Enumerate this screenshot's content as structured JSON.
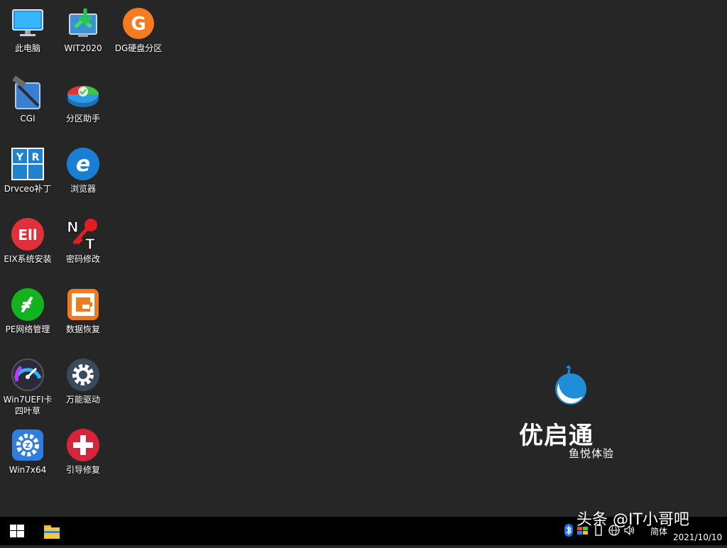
{
  "desktop": {
    "icons": [
      {
        "id": "computer",
        "label": "此电脑",
        "icon": "monitor-icon"
      },
      {
        "id": "wit",
        "label": "WIT2020",
        "icon": "install-arrow-icon"
      },
      {
        "id": "dg",
        "label": "DG硬盘分区",
        "icon": "g-disk-icon"
      },
      {
        "id": "cgi",
        "label": "CGI",
        "icon": "hammer-icon"
      },
      {
        "id": "partition",
        "label": "分区助手",
        "icon": "partition-disk-icon"
      },
      {
        "id": "drvceo",
        "label": "Drvceo补丁",
        "icon": "yr-system-icon"
      },
      {
        "id": "browser",
        "label": "浏览器",
        "icon": "ie-browser-icon"
      },
      {
        "id": "eix",
        "label": "EIX系统安装",
        "icon": "eix-icon"
      },
      {
        "id": "password",
        "label": "密码修改",
        "icon": "nt-key-icon"
      },
      {
        "id": "pe-net",
        "label": "PE网络管理",
        "icon": "network-leaf-icon"
      },
      {
        "id": "recovery",
        "label": "数据恢复",
        "icon": "recovery-g-icon"
      },
      {
        "id": "win7uefi",
        "label": "Win7UEFI卡\n四叶草",
        "icon": "gauge-icon"
      },
      {
        "id": "driver",
        "label": "万能驱动",
        "icon": "gear-icon"
      },
      {
        "id": "win7x64",
        "label": "Win7x64",
        "icon": "puzzle-gear-icon"
      },
      {
        "id": "boot-repair",
        "label": "引导修复",
        "icon": "plus-cross-icon"
      }
    ]
  },
  "brand": {
    "name": "优启通",
    "tagline": "鱼悦体验",
    "colors": {
      "accent": "#3a8fd8",
      "text": "#ffffff"
    }
  },
  "taskbar": {
    "start_icon": "windows-logo-icon",
    "pinned": [
      {
        "icon": "file-explorer-icon"
      }
    ],
    "tray": {
      "icons": [
        "bluetooth-icon",
        "color-flag-icon",
        "battery-icon",
        "network-icon",
        "volume-icon"
      ],
      "language": "简体",
      "date": "2021/10/10"
    }
  },
  "watermark": {
    "text": "头条 @IT小哥吧"
  },
  "colors": {
    "desktop_bg": "#262626",
    "taskbar_bg": "#000000"
  }
}
